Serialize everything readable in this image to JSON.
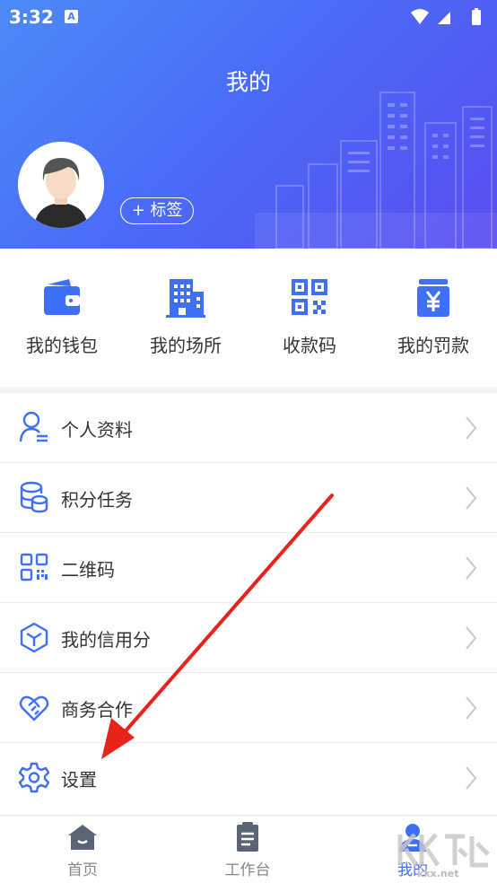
{
  "status_bar": {
    "time": "3:32",
    "app_indicator": "A"
  },
  "header": {
    "title": "我的",
    "tag_button": "+ 标签"
  },
  "quick_actions": [
    {
      "label": "我的钱包",
      "icon": "wallet-icon"
    },
    {
      "label": "我的场所",
      "icon": "building-icon"
    },
    {
      "label": "收款码",
      "icon": "qr-code-icon"
    },
    {
      "label": "我的罚款",
      "icon": "fine-yen-icon"
    }
  ],
  "menu": [
    {
      "label": "个人资料",
      "icon": "user-profile-icon"
    },
    {
      "label": "积分任务",
      "icon": "coins-database-icon"
    },
    {
      "label": "二维码",
      "icon": "qr-grid-icon"
    },
    {
      "label": "我的信用分",
      "icon": "cube-icon"
    },
    {
      "label": "商务合作",
      "icon": "handshake-heart-icon"
    },
    {
      "label": "设置",
      "icon": "gear-icon"
    }
  ],
  "tabs": [
    {
      "label": "首页",
      "icon": "home-icon",
      "active": false
    },
    {
      "label": "工作台",
      "icon": "clipboard-icon",
      "active": false
    },
    {
      "label": "我的",
      "icon": "person-icon",
      "active": true
    }
  ],
  "watermark": "kkx.net",
  "colors": {
    "accent": "#3f6ff5",
    "header_start": "#4d8af8",
    "header_end": "#5a4cf0",
    "arrow": "#e8231c"
  }
}
